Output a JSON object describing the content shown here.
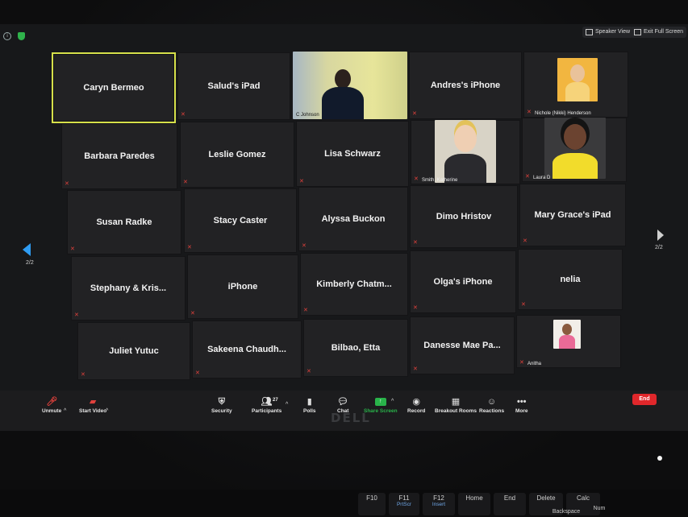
{
  "topbar": {
    "speaker_view": "Speaker View",
    "exit_full_screen": "Exit Full Screen"
  },
  "tiles": {
    "t1": "Caryn Bermeo",
    "t2": "Salud's iPad",
    "t3_caption": "C Johnson",
    "t4": "Andres's iPhone",
    "t5_caption": "Nichole (Nikki) Henderson",
    "t6": "Barbara Paredes",
    "t7": "Leslie Gomez",
    "t8": "Lisa Schwarz",
    "t9_caption": "Smith, Katherine",
    "t10_caption": "Laura D",
    "t11": "Susan Radke",
    "t12": "Stacy Caster",
    "t13": "Alyssa Buckon",
    "t14": "Dimo Hristov",
    "t15": "Mary Grace's iPad",
    "t16": "Stephany & Kris...",
    "t17": "iPhone",
    "t18": "Kimberly Chatm...",
    "t19": "Olga's iPhone",
    "t20": "nelia",
    "t21": "Juliet Yutuc",
    "t22": "Sakeena Chaudh...",
    "t23": "Bilbao, Etta",
    "t24": "Danesse Mae Pa...",
    "t25_caption": "Anitha"
  },
  "pagination": {
    "left": "2/2",
    "right": "2/2"
  },
  "toolbar": {
    "unmute": "Unmute",
    "start_video": "Start Video",
    "security": "Security",
    "participants": "Participants",
    "participants_count": "27",
    "polls": "Polls",
    "chat": "Chat",
    "share_screen": "Share Screen",
    "record": "Record",
    "breakout_rooms": "Breakout Rooms",
    "reactions": "Reactions",
    "more": "More",
    "end": "End"
  },
  "laptop": {
    "logo": "DELL"
  },
  "keyboard": {
    "f10": "F10",
    "f11": "F11",
    "f11_sub": "PrtScr",
    "f12": "F12",
    "f12_sub": "Insert",
    "home": "Home",
    "end": "End",
    "delete": "Delete",
    "calc": "Calc",
    "backspace": "Backspace",
    "num": "Num"
  },
  "colors": {
    "active_border": "#d6e04a",
    "share_green": "#29b34a",
    "end_red": "#e0272b",
    "nav_arrow": "#2f9cf2",
    "muted_mic": "#e0413c"
  }
}
